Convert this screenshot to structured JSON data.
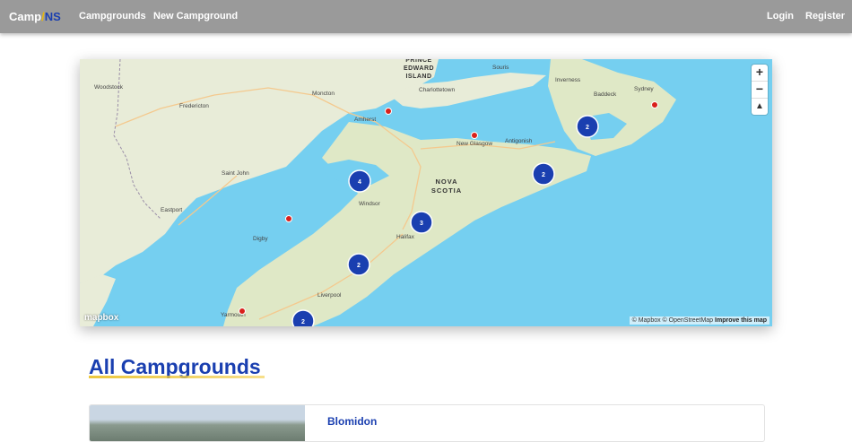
{
  "navbar": {
    "brand_left": "Camp",
    "brand_slash": "/",
    "brand_right": "NS",
    "links": [
      "Campgrounds",
      "New Campground"
    ],
    "login": "Login",
    "register": "Register"
  },
  "map": {
    "labels": {
      "prince_edward_island": "PRINCE\nEDWARD\nISLAND",
      "nova_scotia": "NOVA\nSCOTIA",
      "woodstock": "Woodstock",
      "fredericton": "Fredericton",
      "moncton": "Moncton",
      "saint_john": "Saint John",
      "eastport": "Eastport",
      "amherst": "Amherst",
      "charlottetown": "Charlottetown",
      "souris": "Souris",
      "inverness": "Inverness",
      "baddeck": "Baddeck",
      "sydney": "Sydney",
      "new_glasgow": "New Glasgow",
      "antigonish": "Antigonish",
      "windsor": "Windsor",
      "digby": "Digby",
      "halifax": "Halifax",
      "liverpool": "Liverpool",
      "yarmouth": "Yarmouth"
    },
    "clusters": [
      "2",
      "2",
      "4",
      "3",
      "2",
      "2"
    ],
    "zoom_in": "+",
    "zoom_out": "−",
    "compass": "▲",
    "attribution": "© Mapbox © OpenStreetMap",
    "improve": "Improve this map",
    "logo": "mapbox"
  },
  "section_title": "All Campgrounds",
  "cards": [
    {
      "title": "Blomidon"
    }
  ],
  "colors": {
    "brand": "#1a3fb0",
    "accent": "#e8b90c",
    "navbar": "#9a9a9a",
    "water": "#75cff0",
    "land": "#e8ecd8",
    "cluster": "#1a3fb0",
    "marker": "#d9201c"
  }
}
